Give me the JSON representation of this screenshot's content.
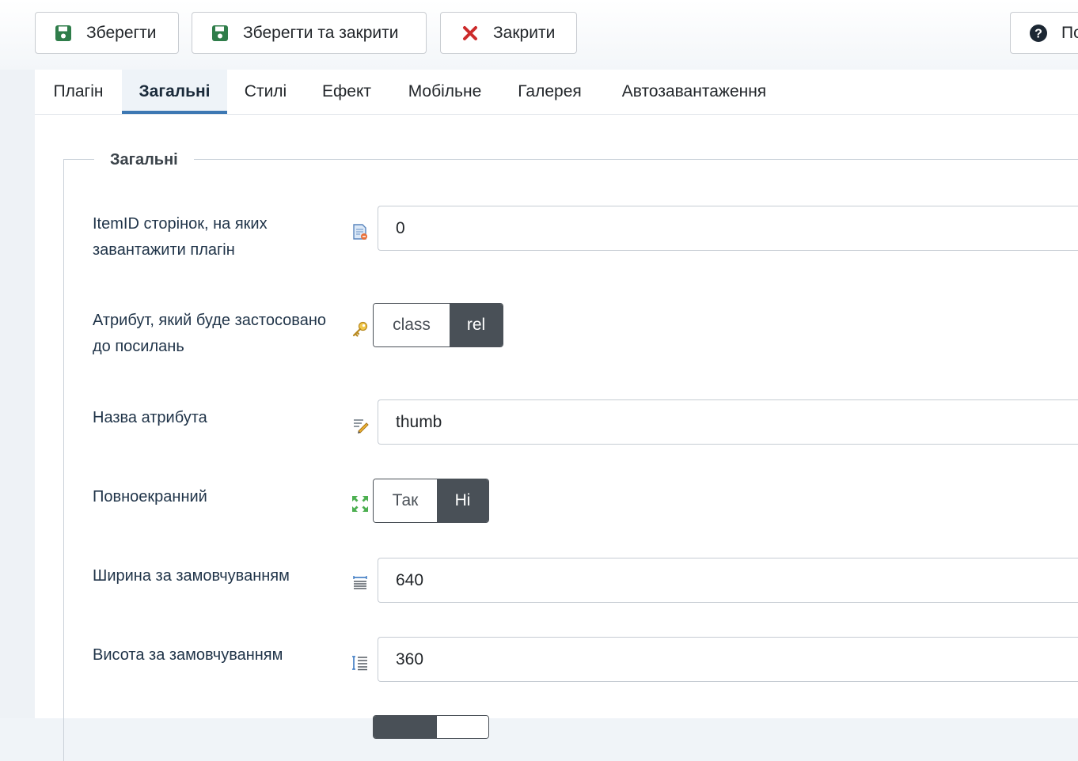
{
  "toolbar": {
    "save_label": "Зберегти",
    "save_close_label": "Зберегти та закрити",
    "close_label": "Закрити",
    "help_label": "По"
  },
  "tabs": [
    {
      "label": "Плагін",
      "active": false
    },
    {
      "label": "Загальні",
      "active": true
    },
    {
      "label": "Стилі",
      "active": false
    },
    {
      "label": "Ефект",
      "active": false
    },
    {
      "label": "Мобільне",
      "active": false
    },
    {
      "label": "Галерея",
      "active": false
    },
    {
      "label": "Автозавантаження",
      "active": false
    }
  ],
  "fieldset": {
    "legend": "Загальні"
  },
  "fields": {
    "itemid": {
      "label": "ItemID сторінок, на яких завантажити плагін",
      "value": "0"
    },
    "attribute": {
      "label": "Атрибут, який буде застосовано до посилань",
      "options": [
        "class",
        "rel"
      ],
      "selected": "rel"
    },
    "attribute_name": {
      "label": "Назва атрибута",
      "value": "thumb"
    },
    "fullscreen": {
      "label": "Повноекранний",
      "options": [
        "Так",
        "Ні"
      ],
      "selected": "Ні"
    },
    "default_width": {
      "label": "Ширина за замовчуванням",
      "value": "640"
    },
    "default_height": {
      "label": "Висота за замовчуванням",
      "value": "360"
    }
  },
  "colors": {
    "save_icon": "#2f7d4a",
    "close_icon": "#cc2b2b",
    "switch_active": "#495057",
    "tab_active_border": "#3d78b3"
  }
}
